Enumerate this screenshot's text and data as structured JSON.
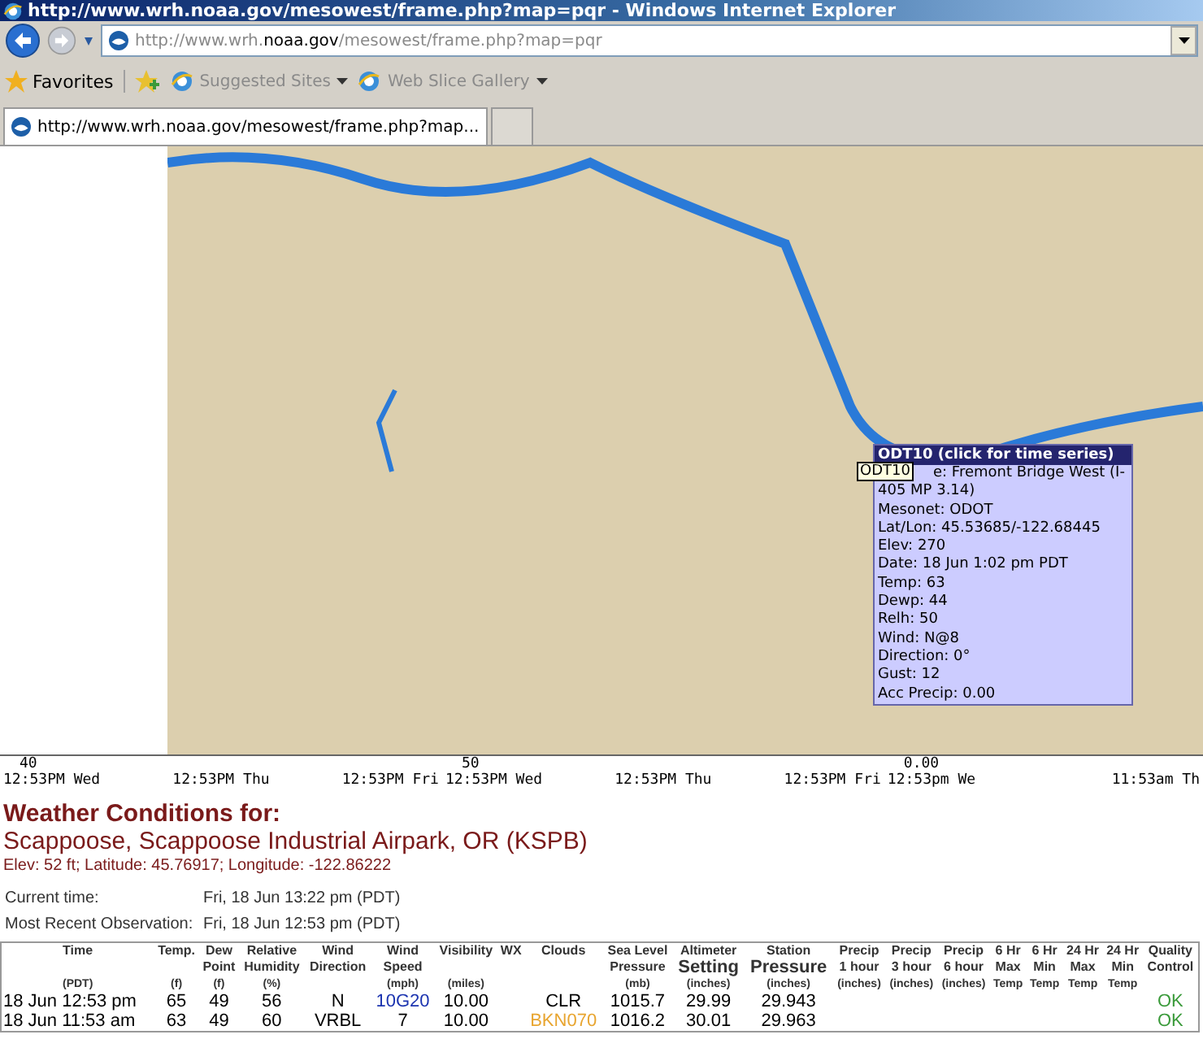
{
  "window": {
    "title": "http://www.wrh.noaa.gov/mesowest/frame.php?map=pqr - Windows Internet Explorer"
  },
  "address_bar": {
    "url": "http://www.wrh.**noaa.gov**/mesowest/frame.php?map=pqr"
  },
  "favorites_bar": {
    "favorites": "Favorites",
    "links": [
      "Suggested Sites",
      "Web Slice Gallery"
    ]
  },
  "tabs": [
    {
      "label": "http://www.wrh.noaa.gov/mesowest/frame.php?map...",
      "selected": true
    }
  ],
  "map": {
    "tooltip": "ODT10",
    "popup": {
      "title": "ODT10 (click for time series)",
      "lines": [
        "e: Fremont Bridge West (I-",
        "405 MP 3.14)",
        "Mesonet: ODOT",
        "Lat/Lon: 45.53685/-122.68445",
        "Elev: 270",
        "Date: 18 Jun 1:02 pm PDT",
        "Temp: 63",
        "Dewp: 44",
        "Relh: 50",
        "Wind: N@8",
        "Direction: 0°",
        "Gust: 12",
        "Acc Precip: 0.00"
      ]
    }
  },
  "timeline": [
    {
      "value": "40",
      "times": [
        "12:53PM Wed",
        "12:53PM Thu",
        "12:53PM Fri"
      ]
    },
    {
      "value": "50",
      "times": [
        "12:53PM Wed",
        "12:53PM Thu",
        "12:53PM Fri"
      ]
    },
    {
      "value": "0.00",
      "times": [
        "12:53pm We",
        "11:53am Th"
      ]
    }
  ],
  "conditions": {
    "heading": "Weather Conditions for:",
    "station": "Scappoose, Scappoose Industrial Airpark, OR (KSPB)",
    "location": "Elev: 52 ft; Latitude: 45.76917; Longitude: -122.86222",
    "info": [
      {
        "label": "Current time:",
        "value": "Fri, 18 Jun 13:22 pm (PDT)"
      },
      {
        "label": "Most Recent Observation:",
        "value": "Fri, 18 Jun 12:53 pm (PDT)"
      }
    ],
    "table": {
      "columns": [
        {
          "heading": [
            {
              "text": "Time",
              "large": false
            }
          ],
          "unit": "(PDT)"
        },
        {
          "heading": [
            {
              "text": "Temp.",
              "large": false
            }
          ],
          "unit": "(f)"
        },
        {
          "heading": [
            {
              "text": "Dew",
              "large": false
            },
            {
              "text": "Point",
              "large": false
            }
          ],
          "unit": "(f)"
        },
        {
          "heading": [
            {
              "text": "Relative",
              "large": false
            },
            {
              "text": "Humidity",
              "large": false
            }
          ],
          "unit": "(%)"
        },
        {
          "heading": [
            {
              "text": "Wind",
              "large": false
            },
            {
              "text": "Direction",
              "large": false
            }
          ]
        },
        {
          "heading": [
            {
              "text": "Wind",
              "large": false
            },
            {
              "text": "Speed",
              "large": false
            }
          ],
          "unit": "(mph)"
        },
        {
          "heading": [
            {
              "text": "Visibility",
              "large": false
            }
          ],
          "unit": "(miles)"
        },
        {
          "heading": [
            {
              "text": "WX",
              "large": false
            }
          ]
        },
        {
          "heading": [
            {
              "text": "Clouds",
              "large": false
            }
          ]
        },
        {
          "heading": [
            {
              "text": "Sea Level",
              "large": false
            },
            {
              "text": "Pressure",
              "large": false
            }
          ],
          "unit": "(mb)"
        },
        {
          "heading": [
            {
              "text": "Altimeter",
              "large": false
            },
            {
              "text": "Setting",
              "large": true
            }
          ],
          "unit": "(inches)"
        },
        {
          "heading": [
            {
              "text": "Station",
              "large": false
            },
            {
              "text": "Pressure",
              "large": true
            }
          ],
          "unit": "(inches)"
        },
        {
          "heading": [
            {
              "text": "Precip",
              "large": false
            },
            {
              "text": "1 hour",
              "large": false
            }
          ],
          "unit": "(inches)"
        },
        {
          "heading": [
            {
              "text": "Precip",
              "large": false
            },
            {
              "text": "3 hour",
              "large": false
            }
          ],
          "unit": "(inches)"
        },
        {
          "heading": [
            {
              "text": "Precip",
              "large": false
            },
            {
              "text": "6 hour",
              "large": false
            }
          ],
          "unit": "(inches)"
        },
        {
          "heading": [
            {
              "text": "6 Hr",
              "large": false
            },
            {
              "text": "Max",
              "large": false
            }
          ],
          "unit": "Temp"
        },
        {
          "heading": [
            {
              "text": "6 Hr",
              "large": false
            },
            {
              "text": "Min",
              "large": false
            }
          ],
          "unit": "Temp"
        },
        {
          "heading": [
            {
              "text": "24 Hr",
              "large": false
            },
            {
              "text": "Max",
              "large": false
            }
          ],
          "unit": "Temp"
        },
        {
          "heading": [
            {
              "text": "24 Hr",
              "large": false
            },
            {
              "text": "Min",
              "large": false
            }
          ],
          "unit": "Temp"
        },
        {
          "heading": [
            {
              "text": "Quality",
              "large": false
            },
            {
              "text": "Control",
              "large": false
            }
          ]
        }
      ],
      "rows": [
        [
          {
            "text": "18 Jun 12:53 pm"
          },
          {
            "text": "65"
          },
          {
            "text": "49"
          },
          {
            "text": "56"
          },
          {
            "text": "N"
          },
          {
            "text": "10G20",
            "color": "#1c34b0"
          },
          {
            "text": "10.00"
          },
          null,
          {
            "text": "CLR"
          },
          {
            "text": "1015.7"
          },
          {
            "text": "29.99"
          },
          {
            "text": "29.943"
          },
          null,
          null,
          null,
          null,
          null,
          null,
          null,
          {
            "text": "OK",
            "color": "#3a9a3a"
          }
        ],
        [
          {
            "text": "18 Jun 11:53 am"
          },
          {
            "text": "63"
          },
          {
            "text": "49"
          },
          {
            "text": "60"
          },
          {
            "text": "VRBL"
          },
          {
            "text": "7"
          },
          {
            "text": "10.00"
          },
          null,
          {
            "text": "BKN070",
            "color": "#e8a530"
          },
          {
            "text": "1016.2"
          },
          {
            "text": "30.01"
          },
          {
            "text": "29.963"
          },
          null,
          null,
          null,
          null,
          null,
          null,
          null,
          {
            "text": "OK",
            "color": "#3a9a3a"
          }
        ]
      ]
    }
  }
}
